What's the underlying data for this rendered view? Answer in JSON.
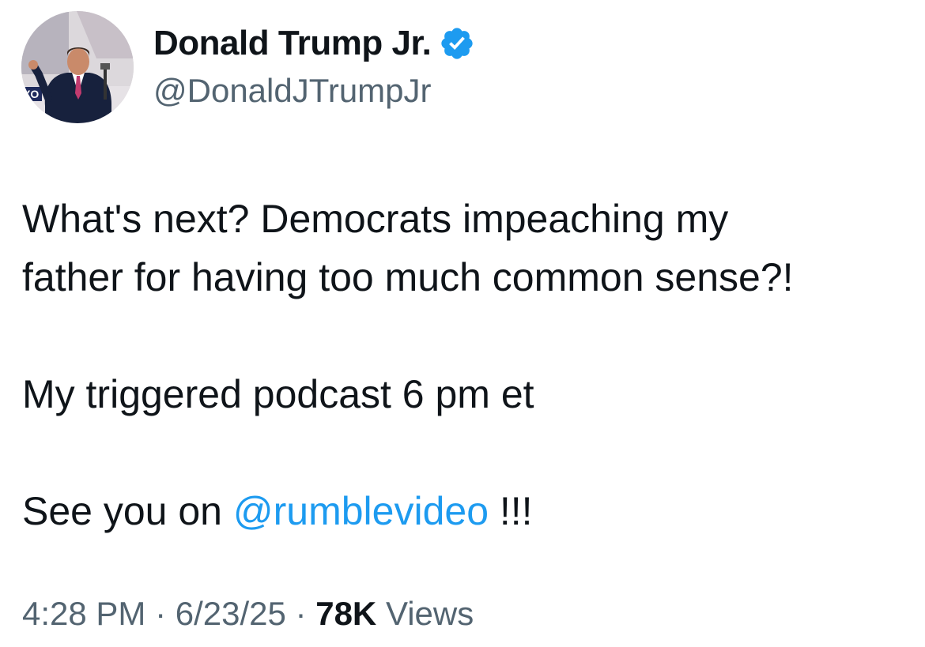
{
  "author": {
    "name": "Donald Trump Jr.",
    "handle": "@DonaldJTrumpJr",
    "verified_icon": "verified-badge-icon",
    "avatar": "profile-photo"
  },
  "tweet": {
    "line1": "What's next? Democrats impeaching my",
    "line2": "father for having too much common sense?!",
    "line3": "My triggered podcast 6 pm et",
    "line4_prefix": "See you on ",
    "mention": "@rumblevideo",
    "line4_suffix": " !!!"
  },
  "meta": {
    "time": "4:28 PM",
    "separator1": " · ",
    "date": "6/23/25",
    "separator2": " · ",
    "views_count": "78K",
    "views_label": " Views"
  },
  "colors": {
    "text": "#0f1419",
    "secondary": "#536471",
    "link": "#1d9bf0",
    "verified": "#1d9bf0"
  }
}
